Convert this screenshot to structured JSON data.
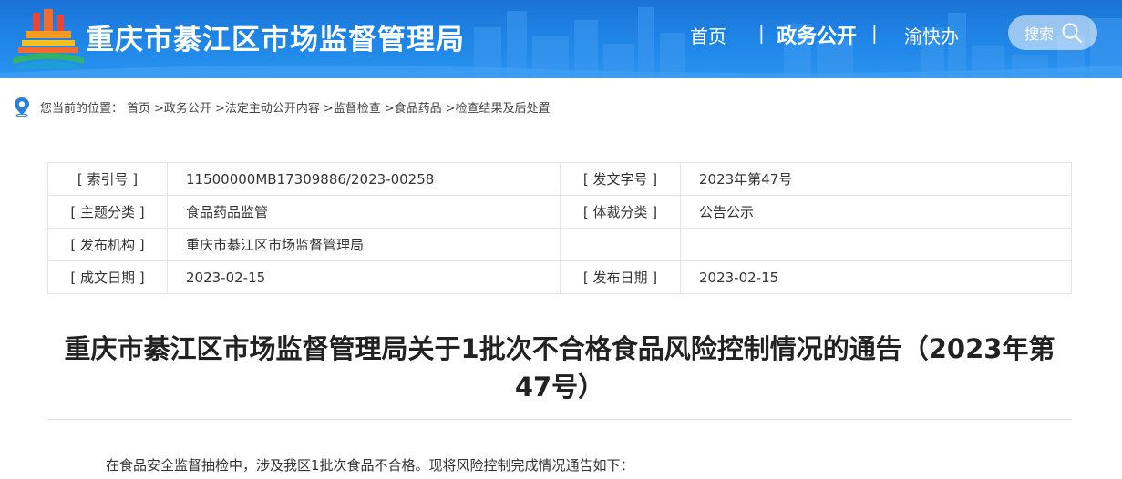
{
  "header": {
    "site_title": "重庆市綦江区市场监督管理局",
    "nav": {
      "home": "首页",
      "separator": "|",
      "gov_affairs": "政务公开",
      "service": "渝快办"
    },
    "search_label": "搜索",
    "colors": {
      "header_bg": "#1f86e8",
      "text": "#ffffff"
    }
  },
  "breadcrumb": {
    "prefix": "您当前的位置：",
    "items": [
      "首页",
      ">政务公开",
      ">法定主动公开内容",
      ">监督检查",
      ">食品药品",
      ">检查结果及后处置"
    ]
  },
  "info_table": {
    "rows": [
      {
        "k1": "[ 索引号 ]",
        "v1": "11500000MB17309886/2023-00258",
        "k2": "[ 发文字号 ]",
        "v2": "2023年第47号"
      },
      {
        "k1": "[ 主题分类 ]",
        "v1": "食品药品监管",
        "k2": "[ 体裁分类 ]",
        "v2": "公告公示"
      },
      {
        "k1": "[ 发布机构 ]",
        "v1": "重庆市綦江区市场监督管理局",
        "k2": "",
        "v2": ""
      },
      {
        "k1": "[ 成文日期 ]",
        "v1": "2023-02-15",
        "k2": "[ 发布日期 ]",
        "v2": "2023-02-15"
      }
    ]
  },
  "article": {
    "title": "重庆市綦江区市场监督管理局关于1批次不合格食品风险控制情况的通告（2023年第47号）",
    "intro": "在食品安全监督抽检中，涉及我区1批次食品不合格。现将风险控制完成情况通告如下："
  }
}
